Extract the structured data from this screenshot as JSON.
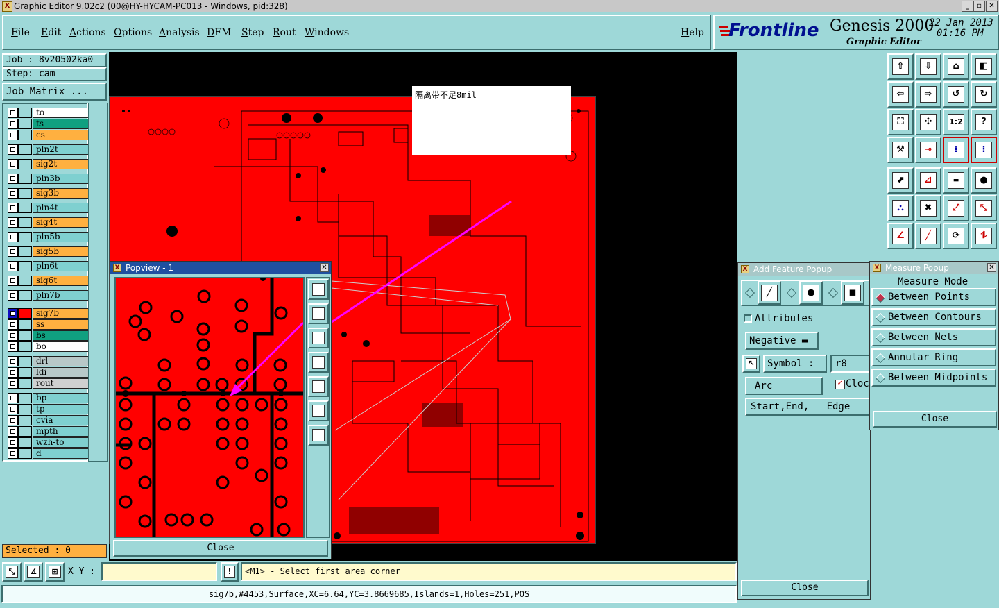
{
  "window": {
    "title": "Graphic Editor 9.02c2 (00@HY-HYCAM-PC013 - Windows, pid:328)"
  },
  "menu": {
    "items": [
      "File",
      "Edit",
      "Actions",
      "Options",
      "Analysis",
      "DFM",
      "Step",
      "Rout",
      "Windows"
    ],
    "help": "Help"
  },
  "brand": {
    "logo": "Frontline",
    "product": "Genesis 2000",
    "subtitle": "Graphic Editor",
    "date": "22 Jan 2013",
    "time": "01:16 PM"
  },
  "job": {
    "job_label": "Job : 8v20502ka0",
    "step_label": "Step: cam",
    "matrix_button": "Job Matrix ..."
  },
  "layers": [
    {
      "name": "to",
      "color": "#ffffff"
    },
    {
      "name": "ts",
      "color": "#10a080"
    },
    {
      "name": "cs",
      "color": "#ffb040"
    },
    {
      "name": "pln2t",
      "color": "#7fd0d0"
    },
    {
      "name": "sig2t",
      "color": "#ffb040"
    },
    {
      "name": "pln3b",
      "color": "#7fd0d0"
    },
    {
      "name": "sig3b",
      "color": "#ffb040"
    },
    {
      "name": "pln4t",
      "color": "#7fd0d0"
    },
    {
      "name": "sig4t",
      "color": "#ffb040"
    },
    {
      "name": "pln5b",
      "color": "#7fd0d0"
    },
    {
      "name": "sig5b",
      "color": "#ffb040"
    },
    {
      "name": "pln6t",
      "color": "#7fd0d0"
    },
    {
      "name": "sig6t",
      "color": "#ffb040"
    },
    {
      "name": "pln7b",
      "color": "#7fd0d0"
    },
    {
      "name": "sig7b",
      "color": "#ffb040",
      "active": true
    },
    {
      "name": "ss",
      "color": "#ffb040"
    },
    {
      "name": "bs",
      "color": "#10a080"
    },
    {
      "name": "bo",
      "color": "#ffffff"
    },
    {
      "name": "drl",
      "color": "#b8c8c8"
    },
    {
      "name": "ldi",
      "color": "#b8c8c8"
    },
    {
      "name": "rout",
      "color": "#d0d0d0"
    },
    {
      "name": "bp",
      "color": "#7fd0d0"
    },
    {
      "name": "tp",
      "color": "#7fd0d0"
    },
    {
      "name": "cvia",
      "color": "#7fd0d0"
    },
    {
      "name": "mpth",
      "color": "#7fd0d0"
    },
    {
      "name": "wzh-to",
      "color": "#7fd0d0"
    },
    {
      "name": "d",
      "color": "#7fd0d0"
    }
  ],
  "selected": "Selected : 0",
  "annotation": {
    "text": "隔离带不足8mil"
  },
  "popview": {
    "title": "Popview - 1",
    "close": "Close"
  },
  "add_feature": {
    "title": "Add Feature Popup",
    "attributes": "Attributes",
    "polarity": "Negative",
    "symbol_label": "Symbol :",
    "symbol_value": "r8",
    "shape": "Arc",
    "clockwise": "Cloc",
    "mode": "Start,End,   Edge",
    "close": "Close"
  },
  "measure": {
    "title": "Measure Popup",
    "heading": "Measure Mode",
    "options": [
      "Between Points",
      "Between Contours",
      "Between Nets",
      "Annular Ring",
      "Between Midpoints"
    ],
    "selected": "Between Points",
    "close": "Close"
  },
  "status": {
    "xy_label": "X Y :",
    "xy_value": "",
    "prompt": "<M1> - Select first area corner",
    "info": "sig7b,#4453,Surface,XC=6.64,YC=3.8669685,Islands=1,Holes=251,POS"
  },
  "colors": {
    "board": "#ff0000",
    "background": "#9ed8d8",
    "arrow": "#ff00ff"
  }
}
